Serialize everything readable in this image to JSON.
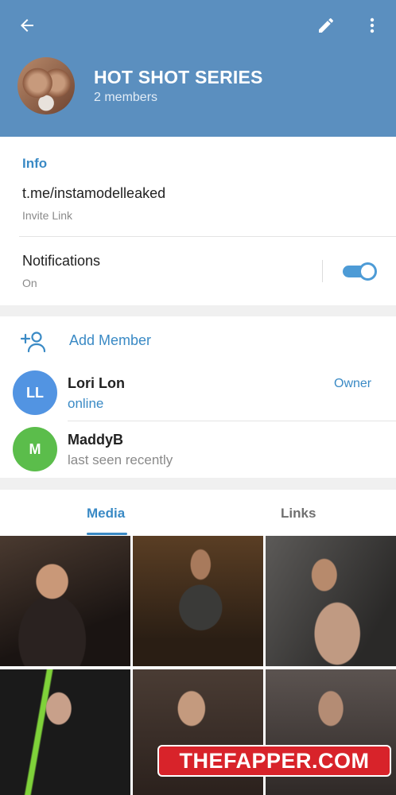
{
  "header": {
    "title": "HOT SHOT SERIES",
    "subtitle": "2 members",
    "back_icon": "arrow-left-icon",
    "edit_icon": "pencil-icon",
    "more_icon": "more-vertical-icon",
    "color": "#5b8fbf"
  },
  "info": {
    "heading": "Info",
    "link": "t.me/instamodelleaked",
    "link_caption": "Invite Link",
    "notifications_label": "Notifications",
    "notifications_state": "On",
    "notifications_enabled": true
  },
  "members": {
    "add_label": "Add Member",
    "add_icon": "add-person-icon",
    "list": [
      {
        "initials": "LL",
        "name": "Lori Lon",
        "status": "online",
        "role": "Owner",
        "avatar_color": "#5294e2",
        "status_color": "#3a8ac5"
      },
      {
        "initials": "M",
        "name": "MaddyB",
        "status": "last seen recently",
        "role": "",
        "avatar_color": "#5bbd4b",
        "status_color": "#8a8a8a"
      }
    ]
  },
  "media": {
    "tabs": [
      {
        "label": "Media",
        "active": true
      },
      {
        "label": "Links",
        "active": false
      }
    ],
    "photo_count_visible": 6
  },
  "watermark": "THEFAPPER.COM",
  "colors": {
    "accent": "#3a8ac5",
    "toggle": "#4d9bd6"
  }
}
